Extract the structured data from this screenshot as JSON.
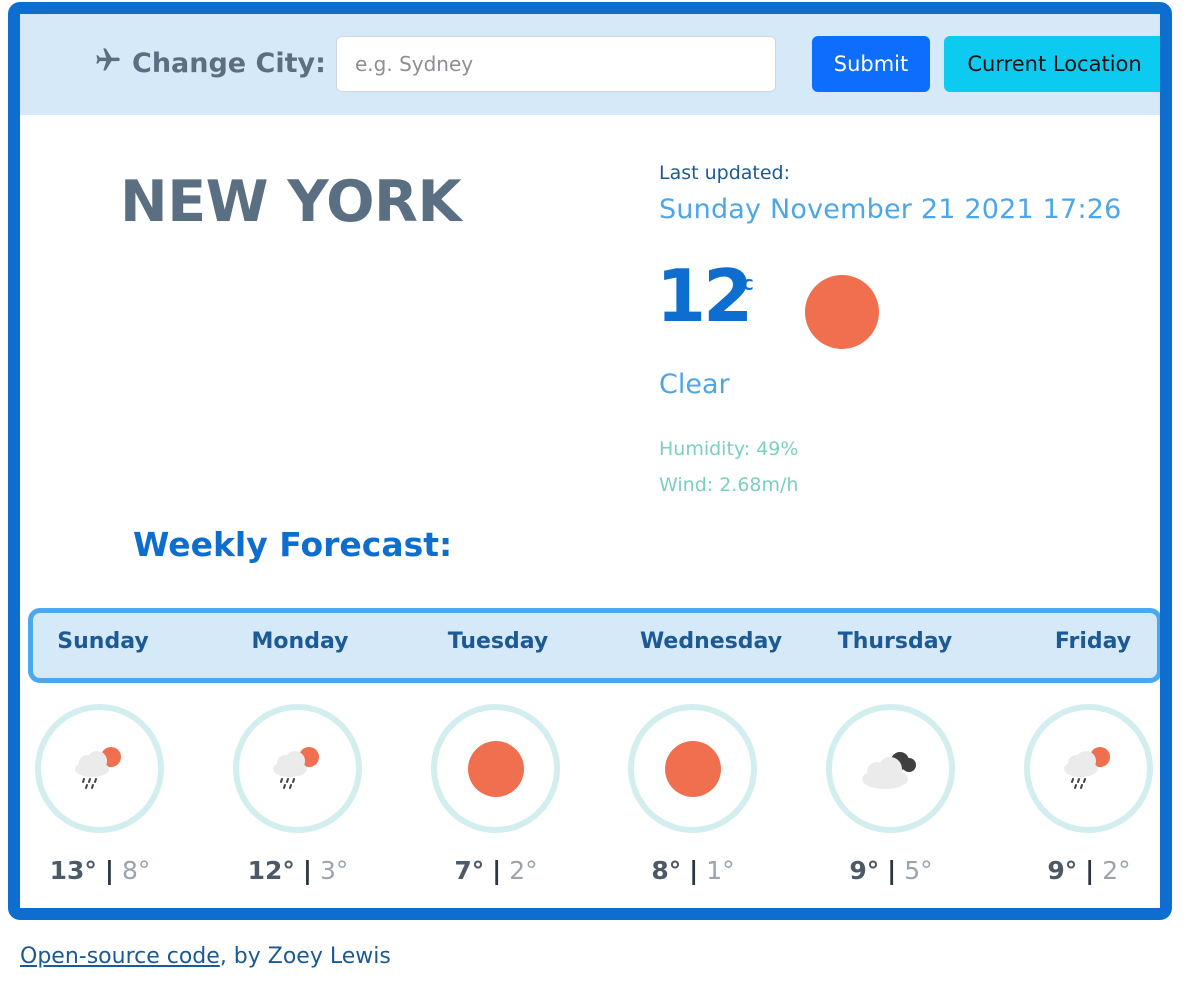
{
  "search": {
    "label": "Change City:",
    "placeholder": "e.g. Sydney",
    "value": "",
    "submit_label": "Submit",
    "location_label": "Current Location",
    "label_icon": "plane-icon"
  },
  "current": {
    "city": "NEW YORK",
    "last_updated_label": "Last updated:",
    "last_updated": "Sunday November 21 2021 17:26",
    "temperature": "12",
    "unit": "°C",
    "icon": "clear-sun-icon",
    "description": "Clear",
    "humidity": "Humidity: 49%",
    "wind": "Wind: 2.68m/h"
  },
  "forecast": {
    "title": "Weekly Forecast:",
    "days": [
      {
        "day": "Sunday",
        "high": "13°",
        "low": "8°",
        "icon": "rain-sun-icon"
      },
      {
        "day": "Monday",
        "high": "12°",
        "low": "3°",
        "icon": "rain-sun-icon"
      },
      {
        "day": "Tuesday",
        "high": "7°",
        "low": "2°",
        "icon": "clear-sun-icon"
      },
      {
        "day": "Wednesday",
        "high": "8°",
        "low": "1°",
        "icon": "clear-sun-icon"
      },
      {
        "day": "Thursday",
        "high": "9°",
        "low": "5°",
        "icon": "cloudy-icon"
      },
      {
        "day": "Friday",
        "high": "9°",
        "low": "2°",
        "icon": "rain-sun-icon"
      }
    ],
    "separator": "|"
  },
  "footer": {
    "link_text": "Open-source code",
    "suffix": ", by Zoey Lewis"
  },
  "colors": {
    "primary": "#0d6ecf",
    "accent_light": "#d6e9f9",
    "sun": "#ef6f4e",
    "submit": "#0d6efd",
    "location": "#0dcaf0"
  }
}
